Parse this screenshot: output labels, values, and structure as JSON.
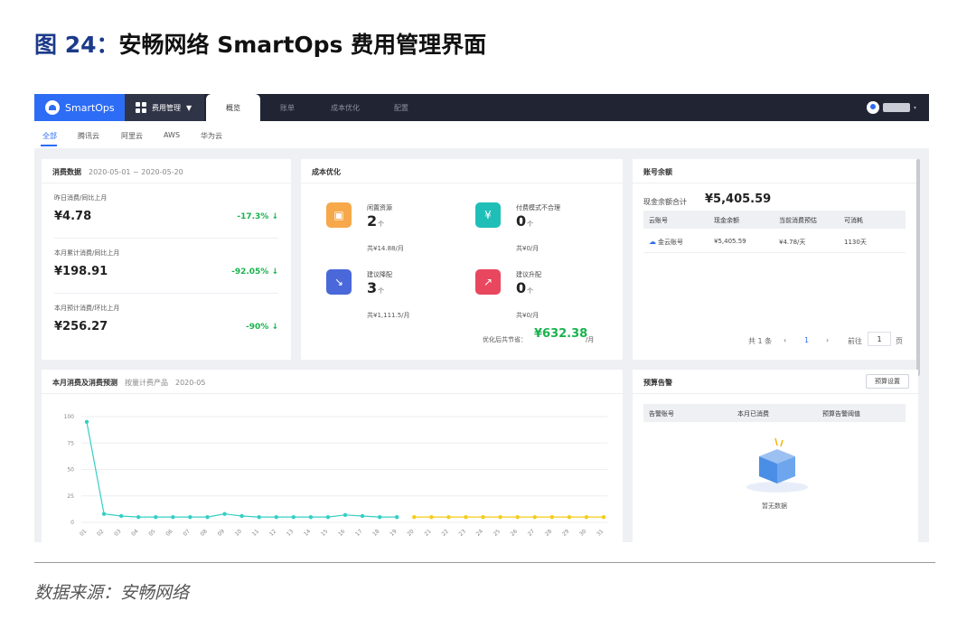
{
  "figure": {
    "number": "图 24：",
    "title": "安畅网络 SmartOps 费用管理界面",
    "source": "数据来源：安畅网络"
  },
  "app": {
    "logo": "SmartOps",
    "menu": "费用管理",
    "tabs": [
      "概览",
      "账单",
      "成本优化",
      "配置"
    ]
  },
  "subtabs": [
    "全部",
    "腾讯云",
    "阿里云",
    "AWS",
    "华为云"
  ],
  "consumption": {
    "title": "消费数据",
    "date_range": "2020-05-01 ~ 2020-05-20",
    "items": [
      {
        "label": "昨日消费/同比上月",
        "value": "¥4.78",
        "change": "-17.3%",
        "arrow": "↓"
      },
      {
        "label": "本月累计消费/同比上月",
        "value": "¥198.91",
        "change": "-92.05%",
        "arrow": "↓"
      },
      {
        "label": "本月预计消费/环比上月",
        "value": "¥256.27",
        "change": "-90%",
        "arrow": "↓"
      }
    ]
  },
  "cost_opt": {
    "title": "成本优化",
    "items": [
      {
        "label": "闲置资源",
        "count": "2",
        "unit": "个",
        "sum": "共¥14.88/月",
        "color": "#f7a84a",
        "icon": "box-icon"
      },
      {
        "label": "付费模式不合理",
        "count": "0",
        "unit": "个",
        "sum": "共¥0/月",
        "color": "#1fbfb8",
        "icon": "money-bag-icon"
      },
      {
        "label": "建议降配",
        "count": "3",
        "unit": "个",
        "sum": "共¥1,111.5/月",
        "color": "#4a68d9",
        "icon": "downgrade-icon"
      },
      {
        "label": "建议升配",
        "count": "0",
        "unit": "个",
        "sum": "共¥0/月",
        "color": "#e8475f",
        "icon": "upgrade-icon"
      }
    ],
    "save_label": "优化后共节省：",
    "save_value": "¥632.38",
    "save_unit": "/月"
  },
  "balance": {
    "title": "账号余额",
    "total_label": "现金余额合计",
    "total_value": "¥5,405.59",
    "headers": [
      "云账号",
      "现金余额",
      "当前消费预估",
      "可消耗"
    ],
    "rows": [
      [
        "金云账号",
        "¥5,405.59",
        "¥4.78/天",
        "1130天"
      ]
    ],
    "pager": {
      "total": "共 1 条",
      "prev": "‹",
      "page": "1",
      "next": "›",
      "goto": "前往",
      "goto_value": "1",
      "page_suffix": "页"
    }
  },
  "chart_section": {
    "title": "本月消费及消费预测",
    "subtitle": "按量计费产品",
    "month": "2020-05"
  },
  "budget": {
    "title": "预算告警",
    "button": "预算设置",
    "headers": [
      "告警账号",
      "本月已消费",
      "预算告警阈值"
    ],
    "empty": "暂无数据"
  },
  "chart_data": {
    "type": "line",
    "x": [
      "01",
      "02",
      "03",
      "04",
      "05",
      "06",
      "07",
      "08",
      "09",
      "10",
      "11",
      "12",
      "13",
      "14",
      "15",
      "16",
      "17",
      "18",
      "19",
      "20",
      "21",
      "22",
      "23",
      "24",
      "25",
      "26",
      "27",
      "28",
      "29",
      "30",
      "31"
    ],
    "ylim": [
      0,
      100
    ],
    "yticks": [
      0,
      25,
      50,
      75,
      100
    ],
    "series": [
      {
        "color": "#35cfc4",
        "values": [
          95,
          8,
          6,
          5,
          5,
          5,
          5,
          5,
          8,
          6,
          5,
          5,
          5,
          5,
          5,
          7,
          6,
          5,
          5,
          null,
          null,
          null,
          null,
          null,
          null,
          null,
          null,
          null,
          null,
          null,
          null
        ]
      },
      {
        "color": "#f5cc1a",
        "values": [
          null,
          null,
          null,
          null,
          null,
          null,
          null,
          null,
          null,
          null,
          null,
          null,
          null,
          null,
          null,
          null,
          null,
          null,
          null,
          5,
          5,
          5,
          5,
          5,
          5,
          5,
          5,
          5,
          5,
          5,
          5
        ]
      }
    ]
  }
}
